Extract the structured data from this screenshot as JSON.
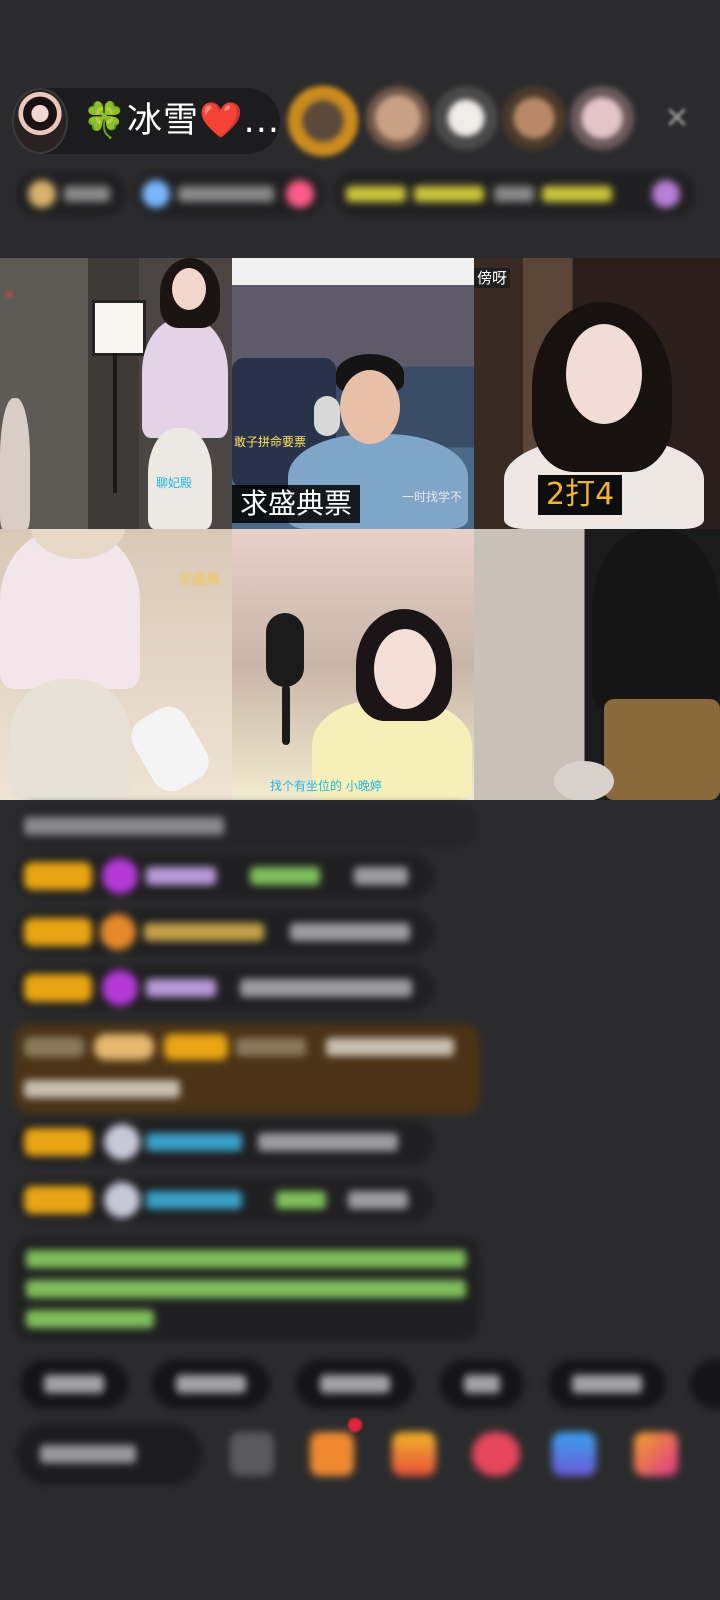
{
  "header": {
    "host_name": "🍀冰雪❤️...",
    "close_icon": "close-icon",
    "close_glyph": "✕"
  },
  "viewers": [
    {
      "color": "#c98a1e"
    },
    {
      "color": "#a07a62"
    },
    {
      "color": "#d8d0c8"
    },
    {
      "color": "#8a6a50"
    },
    {
      "color": "#c9a0a8"
    }
  ],
  "video_tiles": [
    {
      "caption": "",
      "subtitle": "聊妃殿"
    },
    {
      "caption": "求盛典票",
      "subtitle": "一时找学不"
    },
    {
      "caption": "2打4",
      "corner_tag": "傍呀"
    },
    {
      "caption": "",
      "subtitle": "求盛典"
    },
    {
      "caption": "",
      "subtitle": "找个有坐位的 小晚婷"
    },
    {
      "caption": ""
    }
  ],
  "colors": {
    "background": "#2b2b2d",
    "chat_badge": "#e9a514",
    "gift_message_bg": "#4a3316",
    "notice_text": "#7fbf5c",
    "caption_gold": "#f1b430"
  }
}
